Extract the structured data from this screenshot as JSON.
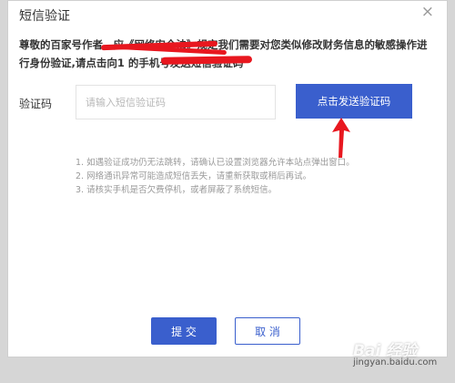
{
  "dialog": {
    "title": "短信验证",
    "close_glyph": "×",
    "notice_line1": "尊敬的百家号作者，应《网络安全法》规定我们需要对您类似修改财务信息的敏感操作进",
    "notice_line2": "行身份验证,请点击向1        的手机号发送短信验证码",
    "code_label": "验证码",
    "code_value": "",
    "code_placeholder": "请输入短信验证码",
    "send_label": "点击发送验证码",
    "tips": [
      "1. 如遇验证成功仍无法跳转，请确认已设置浏览器允许本站点弹出窗口。",
      "2. 网络通讯异常可能造成短信丢失，请重新获取或稍后再试。",
      "3. 请核实手机是否欠费停机，或者屏蔽了系统短信。"
    ],
    "submit_label": "提 交",
    "cancel_label": "取 消"
  },
  "watermark": {
    "logo": "Bai 经验",
    "url": "jingyan.baidu.com"
  },
  "colors": {
    "primary": "#3a5fcd",
    "annotation_red": "#e8171f"
  },
  "icons": {
    "close": "close-icon",
    "annotation": "red-arrow-icon"
  }
}
